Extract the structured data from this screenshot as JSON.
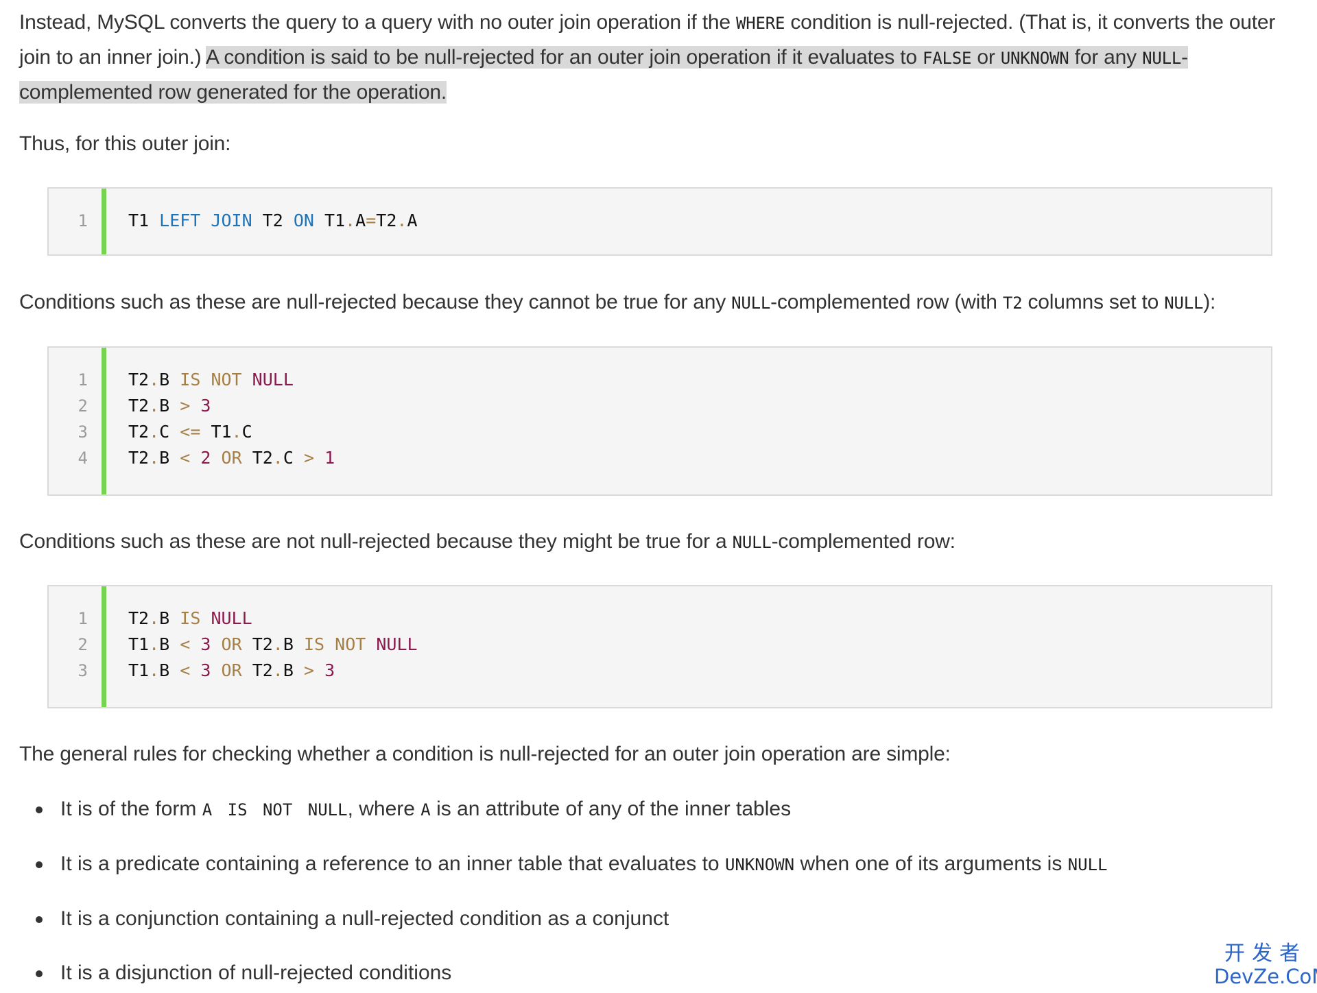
{
  "intro": {
    "text1": "Instead, MySQL converts the query to a query with no outer join operation if the ",
    "code1": "WHERE",
    "text2": " condition is null-rejected. (That is, it converts the outer join to an inner join.) ",
    "hl1": "A condition is said to be null-rejected for an outer join operation if it evaluates to ",
    "code2": "FALSE",
    "hl2": " or ",
    "code3": "UNKNOWN",
    "hl3": " for any ",
    "code4": "NULL",
    "hl4": "-complemented row generated for the operation."
  },
  "thus": "Thus, for this outer join:",
  "code_block_1": {
    "line_numbers": [
      "1"
    ],
    "lines": [
      [
        [
          "T1 ",
          "plain"
        ],
        [
          "LEFT JOIN",
          "kw-blue"
        ],
        [
          " T2 ",
          "plain"
        ],
        [
          "ON",
          "kw-blue"
        ],
        [
          " T1",
          "plain"
        ],
        [
          ".",
          "dot"
        ],
        [
          "A",
          "plain"
        ],
        [
          "=",
          "op"
        ],
        [
          "T2",
          "plain"
        ],
        [
          ".",
          "dot"
        ],
        [
          "A",
          "plain"
        ]
      ]
    ]
  },
  "null_rejected_para": {
    "text1": "Conditions such as these are null-rejected because they cannot be true for any ",
    "code1": "NULL",
    "text2": "-complemented row (with ",
    "code2": "T2",
    "text3": " columns set to ",
    "code3": "NULL",
    "text4": "):"
  },
  "code_block_2": {
    "line_numbers": [
      "1",
      "2",
      "3",
      "4"
    ],
    "lines": [
      [
        [
          "T2",
          "plain"
        ],
        [
          ".",
          "dot"
        ],
        [
          "B ",
          "plain"
        ],
        [
          "IS",
          "kw-olive"
        ],
        [
          " ",
          "plain"
        ],
        [
          "NOT",
          "kw-olive"
        ],
        [
          " ",
          "plain"
        ],
        [
          "NULL",
          "kw-purple"
        ]
      ],
      [
        [
          "T2",
          "plain"
        ],
        [
          ".",
          "dot"
        ],
        [
          "B ",
          "plain"
        ],
        [
          ">",
          "op"
        ],
        [
          " ",
          "plain"
        ],
        [
          "3",
          "num"
        ]
      ],
      [
        [
          "T2",
          "plain"
        ],
        [
          ".",
          "dot"
        ],
        [
          "C ",
          "plain"
        ],
        [
          "<=",
          "op"
        ],
        [
          " T1",
          "plain"
        ],
        [
          ".",
          "dot"
        ],
        [
          "C",
          "plain"
        ]
      ],
      [
        [
          "T2",
          "plain"
        ],
        [
          ".",
          "dot"
        ],
        [
          "B ",
          "plain"
        ],
        [
          "<",
          "op"
        ],
        [
          " ",
          "plain"
        ],
        [
          "2",
          "num"
        ],
        [
          " ",
          "plain"
        ],
        [
          "OR",
          "kw-olive"
        ],
        [
          " T2",
          "plain"
        ],
        [
          ".",
          "dot"
        ],
        [
          "C ",
          "plain"
        ],
        [
          ">",
          "op"
        ],
        [
          " ",
          "plain"
        ],
        [
          "1",
          "num"
        ]
      ]
    ]
  },
  "not_null_rejected_para": {
    "text1": "Conditions such as these are not null-rejected because they might be true for a ",
    "code1": "NULL",
    "text2": "-complemented row:"
  },
  "code_block_3": {
    "line_numbers": [
      "1",
      "2",
      "3"
    ],
    "lines": [
      [
        [
          "T2",
          "plain"
        ],
        [
          ".",
          "dot"
        ],
        [
          "B ",
          "plain"
        ],
        [
          "IS",
          "kw-olive"
        ],
        [
          " ",
          "plain"
        ],
        [
          "NULL",
          "kw-purple"
        ]
      ],
      [
        [
          "T1",
          "plain"
        ],
        [
          ".",
          "dot"
        ],
        [
          "B ",
          "plain"
        ],
        [
          "<",
          "op"
        ],
        [
          " ",
          "plain"
        ],
        [
          "3",
          "num"
        ],
        [
          " ",
          "plain"
        ],
        [
          "OR",
          "kw-olive"
        ],
        [
          " T2",
          "plain"
        ],
        [
          ".",
          "dot"
        ],
        [
          "B ",
          "plain"
        ],
        [
          "IS",
          "kw-olive"
        ],
        [
          " ",
          "plain"
        ],
        [
          "NOT",
          "kw-olive"
        ],
        [
          " ",
          "plain"
        ],
        [
          "NULL",
          "kw-purple"
        ]
      ],
      [
        [
          "T1",
          "plain"
        ],
        [
          ".",
          "dot"
        ],
        [
          "B ",
          "plain"
        ],
        [
          "<",
          "op"
        ],
        [
          " ",
          "plain"
        ],
        [
          "3",
          "num"
        ],
        [
          " ",
          "plain"
        ],
        [
          "OR",
          "kw-olive"
        ],
        [
          " T2",
          "plain"
        ],
        [
          ".",
          "dot"
        ],
        [
          "B ",
          "plain"
        ],
        [
          ">",
          "op"
        ],
        [
          " ",
          "plain"
        ],
        [
          "3",
          "num"
        ]
      ]
    ]
  },
  "general_rules_intro": "The general rules for checking whether a condition is null-rejected for an outer join operation are simple:",
  "rules": {
    "r1": {
      "text1": "It is of the form ",
      "code1": "A IS NOT NULL",
      "text2": ", where ",
      "code2": "A",
      "text3": " is an attribute of any of the inner tables"
    },
    "r2": {
      "text1": "It is a predicate containing a reference to an inner table that evaluates to ",
      "code1": "UNKNOWN",
      "text2": " when one of its arguments is ",
      "code2": "NULL"
    },
    "r3": {
      "text1": "It is a conjunction containing a null-rejected condition as a conjunct"
    },
    "r4": {
      "text1": "It is a disjunction of null-rejected conditions"
    }
  },
  "watermark": {
    "line1": "开发者",
    "line2": "DevZe.CoM"
  }
}
